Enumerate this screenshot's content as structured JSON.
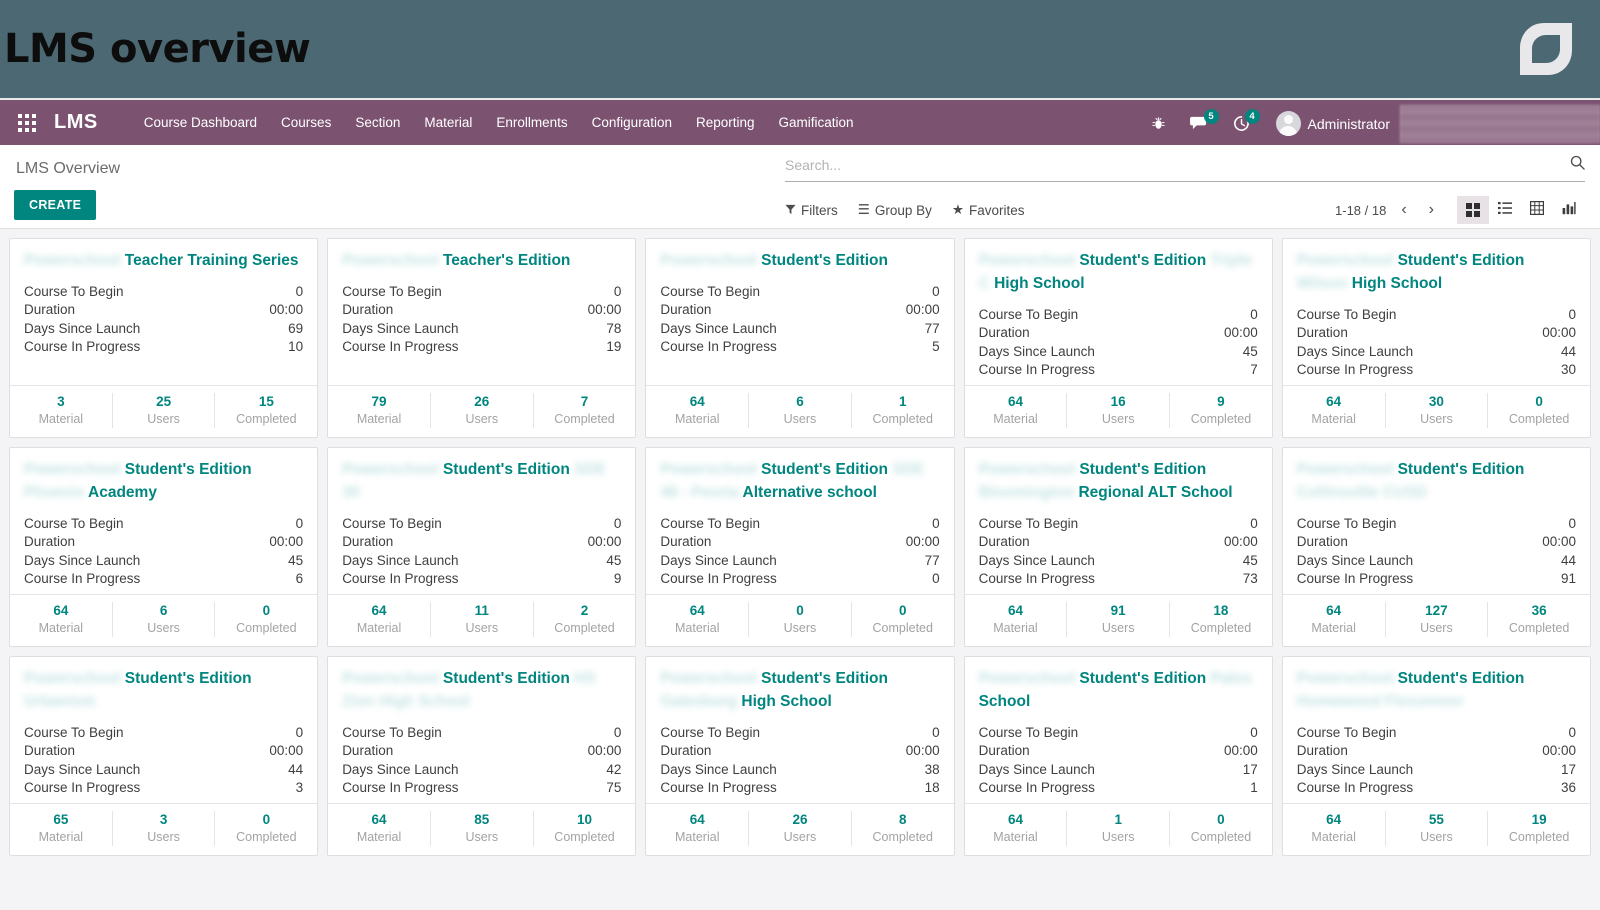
{
  "banner": {
    "title": "LMS overview",
    "logo_icon": "odoo-leaf-logo",
    "bg_color": "#4c6872"
  },
  "navbar": {
    "apps_icon": "apps-grid-icon",
    "brand": "LMS",
    "bg_color": "#7c5271",
    "menu": [
      {
        "label": "Course Dashboard"
      },
      {
        "label": "Courses"
      },
      {
        "label": "Section"
      },
      {
        "label": "Material"
      },
      {
        "label": "Enrollments"
      },
      {
        "label": "Configuration"
      },
      {
        "label": "Reporting"
      },
      {
        "label": "Gamification"
      }
    ],
    "icons": [
      {
        "name": "bug-icon",
        "glyph": "🐞",
        "badge": null
      },
      {
        "name": "messages-icon",
        "glyph": "💬",
        "badge": "5"
      },
      {
        "name": "activities-icon",
        "glyph": "⏱",
        "badge": "4"
      }
    ],
    "user": {
      "avatar_icon": "user-avatar",
      "name": "Administrator",
      "redacted": ""
    }
  },
  "control_panel": {
    "breadcrumb": "LMS Overview",
    "create_label": "CREATE",
    "accent_color": "#00857f",
    "search": {
      "placeholder": "Search...",
      "value": "",
      "icon": "search-icon"
    },
    "filters": [
      {
        "name": "filters",
        "label": "Filters",
        "icon": "funnel-icon",
        "glyph": "▼"
      },
      {
        "name": "group-by",
        "label": "Group By",
        "icon": "hamburger-icon",
        "glyph": "☰"
      },
      {
        "name": "favorites",
        "label": "Favorites",
        "icon": "star-icon",
        "glyph": "★"
      }
    ],
    "pager": {
      "range": "1-18 / 18",
      "prev_icon": "chevron-left-icon",
      "next_icon": "chevron-right-icon",
      "prev_glyph": "‹",
      "next_glyph": "›"
    },
    "views": [
      {
        "name": "kanban-view",
        "icon": "kanban-icon",
        "active": true
      },
      {
        "name": "list-view",
        "icon": "list-icon",
        "glyph": "☰",
        "active": false
      },
      {
        "name": "pivot-view",
        "icon": "grid-icon",
        "glyph": "▦",
        "active": false
      },
      {
        "name": "graph-view",
        "icon": "bar-chart-icon",
        "glyph": "ᵜ▐",
        "active": false
      }
    ]
  },
  "kanban": {
    "stat_labels": [
      "Course To Begin",
      "Duration",
      "Days Since Launch",
      "Course In Progress"
    ],
    "footer_labels": [
      "Material",
      "Users",
      "Completed"
    ],
    "cards": [
      {
        "title_redacted": "Powerschool",
        "title": "Teacher Training Series",
        "stats": [
          "0",
          "00:00",
          "69",
          "10"
        ],
        "footer": [
          "3",
          "25",
          "15"
        ]
      },
      {
        "title_redacted": "Powerschool",
        "title": "Teacher's Edition",
        "stats": [
          "0",
          "00:00",
          "78",
          "19"
        ],
        "footer": [
          "79",
          "26",
          "7"
        ]
      },
      {
        "title_redacted": "Powerschool",
        "title": "Student's Edition",
        "stats": [
          "0",
          "00:00",
          "77",
          "5"
        ],
        "footer": [
          "64",
          "6",
          "1"
        ]
      },
      {
        "title_redacted": "Powerschool",
        "title": "Student's Edition",
        "title_redacted2": "Triple C",
        "title2": "High School",
        "stats": [
          "0",
          "00:00",
          "45",
          "7"
        ],
        "footer": [
          "64",
          "16",
          "9"
        ]
      },
      {
        "title_redacted": "Powerschool",
        "title": "Student's Edition",
        "title_redacted2": "Wilson",
        "title2": "High School",
        "stats": [
          "0",
          "00:00",
          "44",
          "30"
        ],
        "footer": [
          "64",
          "30",
          "0"
        ]
      },
      {
        "title_redacted": "Powerschool",
        "title": "Student's Edition",
        "title_redacted2": "Phoenix",
        "title2": "Academy",
        "stats": [
          "0",
          "00:00",
          "45",
          "6"
        ],
        "footer": [
          "64",
          "6",
          "0"
        ]
      },
      {
        "title_redacted": "Powerschool",
        "title": "Student's Edition",
        "title_redacted2": "SDE 30",
        "title2": "",
        "stats": [
          "0",
          "00:00",
          "45",
          "9"
        ],
        "footer": [
          "64",
          "11",
          "2"
        ]
      },
      {
        "title_redacted": "Powerschool",
        "title": "Student's Edition",
        "title_redacted2": "SDE 48 - Peoria",
        "title2": "Alternative school",
        "stats": [
          "0",
          "00:00",
          "77",
          "0"
        ],
        "footer": [
          "64",
          "0",
          "0"
        ]
      },
      {
        "title_redacted": "Powerschool",
        "title": "Student's Edition",
        "title_redacted2": "Bloomington",
        "title2": "Regional ALT School",
        "stats": [
          "0",
          "00:00",
          "45",
          "73"
        ],
        "footer": [
          "64",
          "91",
          "18"
        ]
      },
      {
        "title_redacted": "Powerschool",
        "title": "Student's Edition",
        "title_redacted2": "Collinsville CUSD",
        "title2": "",
        "stats": [
          "0",
          "00:00",
          "44",
          "91"
        ],
        "footer": [
          "64",
          "127",
          "36"
        ]
      },
      {
        "title_redacted": "Powerschool",
        "title": "Student's Edition",
        "title_redacted2": "Urbanism",
        "title2": "",
        "stats": [
          "0",
          "00:00",
          "44",
          "3"
        ],
        "footer": [
          "65",
          "3",
          "0"
        ]
      },
      {
        "title_redacted": "Powerschool",
        "title": "Student's Edition",
        "title_suffix_redacted": "HS",
        "title_redacted2": "Zion High School",
        "title2": "",
        "stats": [
          "0",
          "00:00",
          "42",
          "75"
        ],
        "footer": [
          "64",
          "85",
          "10"
        ]
      },
      {
        "title_redacted": "Powerschool",
        "title": "Student's Edition",
        "title_redacted2": "Galesburg",
        "title2": "High School",
        "stats": [
          "0",
          "00:00",
          "38",
          "18"
        ],
        "footer": [
          "64",
          "26",
          "8"
        ]
      },
      {
        "title_redacted": "Powerschool",
        "title": "Student's Edition",
        "title_redacted2": "Palos",
        "title2": "School",
        "stats": [
          "0",
          "00:00",
          "17",
          "1"
        ],
        "footer": [
          "64",
          "1",
          "0"
        ]
      },
      {
        "title_redacted": "Powerschool",
        "title": "Student's Edition",
        "title_redacted2": "Homewood Flossmoor",
        "title2": "",
        "stats": [
          "0",
          "00:00",
          "17",
          "36"
        ],
        "footer": [
          "64",
          "55",
          "19"
        ]
      }
    ]
  }
}
